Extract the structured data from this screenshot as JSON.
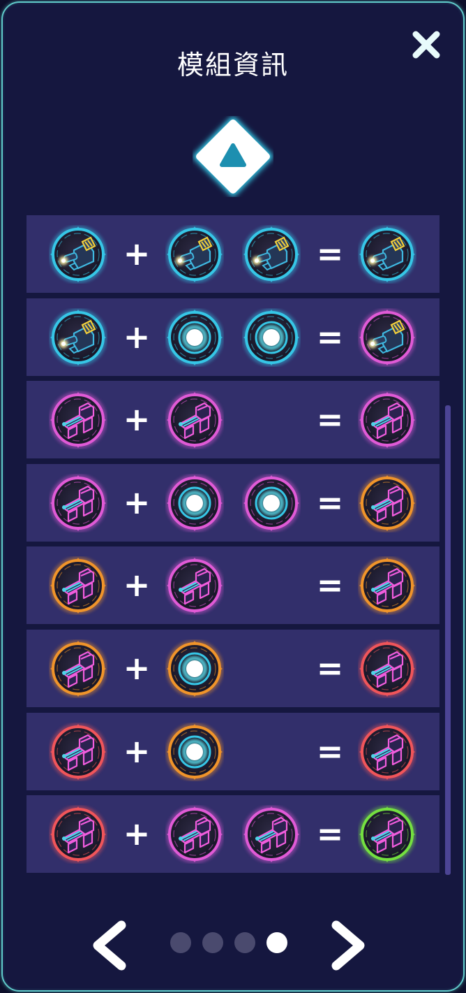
{
  "title": "模組資訊",
  "icons": {
    "close": "close-x-icon",
    "tier": "triangle-tier-badge-icon",
    "prev": "chevron-left-icon",
    "next": "chevron-right-icon"
  },
  "colors": {
    "cyan": "#36c6e6",
    "magenta": "#e05ad6",
    "orange": "#f0942a",
    "red": "#f0555a",
    "green": "#74e040"
  },
  "operators": {
    "plus": "+",
    "equals": "="
  },
  "recipes": [
    {
      "inputs": [
        {
          "type": "cannon",
          "rarity": "cyan"
        },
        {
          "type": "cannon",
          "rarity": "cyan"
        },
        {
          "type": "cannon",
          "rarity": "cyan"
        }
      ],
      "result": {
        "type": "cannon",
        "rarity": "cyan"
      }
    },
    {
      "inputs": [
        {
          "type": "cannon",
          "rarity": "cyan"
        },
        {
          "type": "core",
          "rarity": "cyan"
        },
        {
          "type": "core",
          "rarity": "cyan"
        }
      ],
      "result": {
        "type": "cannon",
        "rarity": "magenta"
      }
    },
    {
      "inputs": [
        {
          "type": "factory",
          "rarity": "magenta"
        },
        {
          "type": "factory",
          "rarity": "magenta"
        }
      ],
      "result": {
        "type": "factory",
        "rarity": "magenta"
      }
    },
    {
      "inputs": [
        {
          "type": "factory",
          "rarity": "magenta"
        },
        {
          "type": "core",
          "rarity": "magenta"
        },
        {
          "type": "core",
          "rarity": "magenta"
        }
      ],
      "result": {
        "type": "factory",
        "rarity": "orange"
      }
    },
    {
      "inputs": [
        {
          "type": "factory",
          "rarity": "orange"
        },
        {
          "type": "factory",
          "rarity": "magenta"
        }
      ],
      "result": {
        "type": "factory",
        "rarity": "orange"
      }
    },
    {
      "inputs": [
        {
          "type": "factory",
          "rarity": "orange"
        },
        {
          "type": "core",
          "rarity": "orange"
        }
      ],
      "result": {
        "type": "factory",
        "rarity": "red"
      }
    },
    {
      "inputs": [
        {
          "type": "factory",
          "rarity": "red"
        },
        {
          "type": "core",
          "rarity": "orange"
        }
      ],
      "result": {
        "type": "factory",
        "rarity": "red"
      }
    },
    {
      "inputs": [
        {
          "type": "factory",
          "rarity": "red"
        },
        {
          "type": "factory",
          "rarity": "magenta"
        },
        {
          "type": "factory",
          "rarity": "magenta"
        }
      ],
      "result": {
        "type": "factory",
        "rarity": "green"
      }
    }
  ],
  "pagination": {
    "total": 4,
    "current": 4
  }
}
